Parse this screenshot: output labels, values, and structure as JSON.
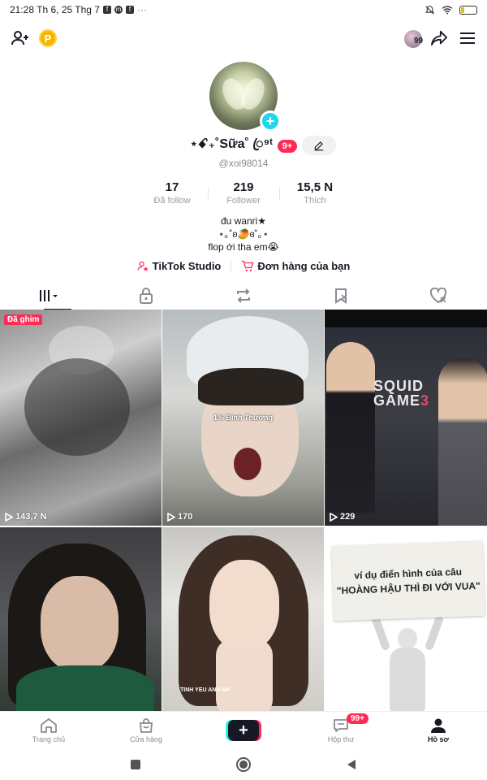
{
  "status_bar": {
    "time_date": "21:28 Th 6, 25 Thg 7",
    "notif_icons": [
      "facebook-icon",
      "messenger-icon",
      "facebook-icon"
    ],
    "more": "···",
    "battery_level": 0.18
  },
  "top_bar": {
    "left_icons": [
      "add-friend-icon",
      "coin-icon"
    ],
    "coin_label": "P",
    "visitor_count": "99",
    "right_icons": [
      "share-icon",
      "menu-icon"
    ]
  },
  "profile": {
    "display_name": "⋆ꗃ₊˚Sữa˚ ꦿ⁹ᵗ",
    "name_badge": "9+",
    "handle": "@xoi98014",
    "stats": [
      {
        "num": "17",
        "label": "Đã follow"
      },
      {
        "num": "219",
        "label": "Follower"
      },
      {
        "num": "15,5 N",
        "label": "Thích"
      }
    ],
    "bio": [
      "đu wanri★",
      "⋆｡˚ʚ🥭ɞ˚｡⋆",
      "flop ới tha em😭"
    ],
    "links": [
      {
        "icon": "tiktok-studio-icon",
        "label": "TikTok Studio"
      },
      {
        "icon": "cart-icon",
        "label": "Đơn hàng của bạn"
      }
    ]
  },
  "tabs": [
    {
      "icon": "grid-videos-icon",
      "active": true
    },
    {
      "icon": "lock-icon",
      "active": false
    },
    {
      "icon": "repost-icon",
      "active": false
    },
    {
      "icon": "bookmark-icon",
      "active": false
    },
    {
      "icon": "liked-heart-icon",
      "active": false
    }
  ],
  "videos": [
    {
      "views": "143,7 N",
      "pinned_label": "Đã ghim"
    },
    {
      "views": "170",
      "caption": "1% Bình Thường"
    },
    {
      "views": "229",
      "logo_a": "SQUID",
      "logo_b": "GAME",
      "logo_c": "3"
    },
    {
      "views": ""
    },
    {
      "views": "",
      "caption": "TINH YEU ANH NH"
    },
    {
      "views": "",
      "board_line1": "ví dụ điển hình của câu",
      "board_line2": "\"HOÀNG HẬU THÌ ĐI VỚI VUA\""
    }
  ],
  "bottom_nav": [
    {
      "icon": "home-icon",
      "label": "Trang chủ"
    },
    {
      "icon": "shop-icon",
      "label": "Cửa hàng"
    },
    {
      "icon": "create-icon",
      "label": ""
    },
    {
      "icon": "inbox-icon",
      "label": "Hộp thư",
      "badge": "99+"
    },
    {
      "icon": "profile-icon",
      "label": "Hồ sơ",
      "active": true
    }
  ],
  "colors": {
    "accent_red": "#fe2c55",
    "accent_cyan": "#20d5ec",
    "text": "#161823",
    "muted": "#8a8b91"
  }
}
